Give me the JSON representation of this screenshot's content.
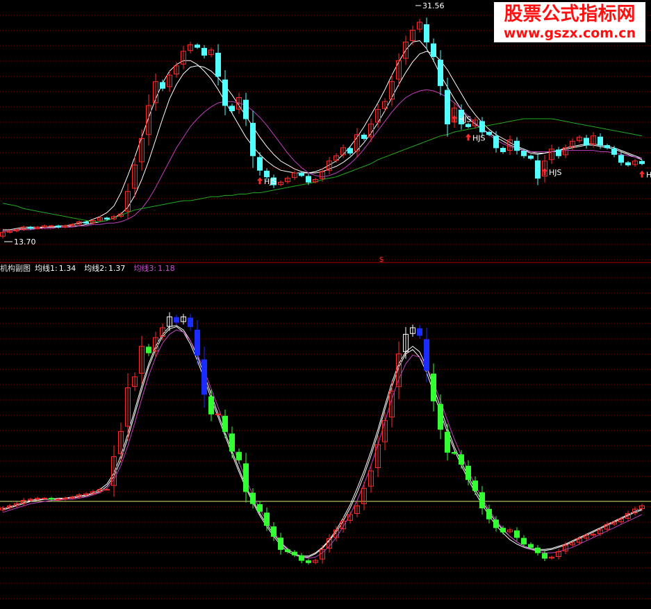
{
  "colors": {
    "up": "#ff2a2a",
    "down": "#33ff33",
    "cyan": "#54ffff",
    "blue": "#1a2cff",
    "white": "#ffffff",
    "magenta": "#c040c0",
    "green": "#22aa22",
    "grid": "#7a0000",
    "yellow": "#e8e880",
    "watermark": "#ff1010",
    "marker_text": "#ffffff"
  },
  "price_panel": {
    "high_label": "31.56",
    "low_label": "13.70",
    "marker_text": "HJS",
    "center_marker": "$"
  },
  "indicator_panel": {
    "name": "机构副图",
    "ma1_label": "均线1:",
    "ma1_value": "1.34",
    "ma2_label": "均线2:",
    "ma2_value": "1.37",
    "ma3_label": "均线3:",
    "ma3_value": "1.18"
  },
  "watermark": {
    "title": "股票公式指标网",
    "url": "www.gszx.com.cn"
  },
  "chart_data": [
    {
      "type": "candlestick",
      "title": "",
      "y_max": 31.56,
      "y_min": 13.7,
      "x": [
        1,
        2,
        3,
        4,
        5,
        6,
        7,
        8,
        9,
        10,
        11,
        12,
        13,
        14,
        15,
        16,
        17,
        18,
        19,
        20,
        21,
        22,
        23,
        24,
        25,
        26,
        27,
        28,
        29,
        30,
        31,
        32,
        33,
        34,
        35,
        36,
        37,
        38,
        39,
        40,
        41,
        42,
        43,
        44,
        45,
        46,
        47,
        48,
        49,
        50,
        51,
        52,
        53,
        54,
        55,
        56,
        57,
        58,
        59,
        60,
        61,
        62,
        63,
        64,
        65,
        66,
        67,
        68,
        69,
        70,
        71,
        72,
        73,
        74,
        75,
        76,
        77,
        78,
        79,
        80,
        81,
        82,
        83,
        84,
        85,
        86,
        87,
        88,
        89,
        90,
        91,
        92,
        93
      ],
      "close": [
        14.4,
        14.5,
        14.6,
        14.8,
        14.7,
        14.8,
        14.9,
        14.9,
        14.8,
        14.9,
        15.0,
        15.2,
        15.1,
        15.3,
        15.5,
        15.4,
        15.6,
        15.8,
        17.5,
        19.5,
        21.5,
        24.0,
        25.8,
        25.3,
        26.3,
        27.0,
        28.1,
        28.6,
        28.4,
        27.8,
        28.2,
        26.2,
        24.0,
        23.6,
        24.6,
        23.0,
        20.2,
        19.1,
        18.6,
        18.0,
        18.2,
        18.5,
        18.9,
        18.7,
        18.2,
        18.4,
        19.0,
        19.8,
        20.2,
        20.8,
        20.4,
        21.8,
        21.5,
        22.6,
        23.7,
        24.3,
        25.8,
        27.4,
        28.8,
        29.7,
        30.3,
        28.8,
        27.7,
        25.5,
        22.6,
        23.8,
        22.6,
        22.4,
        22.9,
        22.0,
        21.8,
        20.8,
        20.5,
        21.4,
        20.6,
        20.2,
        20.0,
        18.5,
        19.8,
        20.7,
        20.2,
        20.8,
        21.3,
        21.6,
        21.0,
        21.7,
        21.0,
        20.8,
        20.3,
        19.7,
        19.5,
        19.8,
        19.6
      ],
      "ma_series": [
        {
          "name": "",
          "color": "white",
          "values": [
            14.6,
            14.6,
            14.7,
            14.8,
            14.8,
            14.8,
            14.8,
            14.8,
            14.9,
            14.9,
            15.0,
            15.1,
            15.2,
            15.4,
            15.6,
            15.9,
            16.4,
            17.4,
            18.7,
            20.1,
            21.6,
            23.1,
            24.5,
            25.7,
            26.6,
            27.1,
            27.4,
            27.4,
            27.1,
            26.6,
            26.0,
            25.2,
            24.3,
            23.4,
            22.5,
            21.6,
            20.9,
            20.3,
            19.8,
            19.4,
            19.1,
            19.0,
            18.9,
            18.9,
            18.9,
            19.0,
            19.2,
            19.5,
            19.8,
            20.3,
            20.9,
            21.6,
            22.4,
            23.3,
            24.2,
            25.2,
            26.3,
            27.3,
            28.2,
            28.8,
            28.9,
            28.3,
            27.4,
            26.3,
            25.4,
            24.5,
            23.7,
            23.0,
            22.6,
            22.2,
            21.9,
            21.6,
            21.3,
            21.0,
            20.8,
            20.6,
            20.4,
            20.3,
            20.4,
            20.5,
            20.6,
            20.8,
            20.9,
            21.0,
            21.1,
            21.1,
            21.0,
            20.9,
            20.8,
            20.6,
            20.4,
            20.2,
            20.0
          ]
        },
        {
          "name": "",
          "color": "white",
          "values": [
            14.5,
            14.5,
            14.6,
            14.7,
            14.7,
            14.7,
            14.8,
            14.8,
            14.8,
            14.8,
            14.9,
            14.9,
            15.0,
            15.1,
            15.2,
            15.3,
            15.5,
            15.8,
            16.3,
            17.2,
            18.4,
            19.8,
            21.4,
            23.0,
            24.5,
            25.6,
            26.4,
            26.9,
            27.0,
            26.9,
            26.6,
            26.1,
            25.5,
            24.8,
            24.0,
            23.2,
            22.4,
            21.6,
            20.9,
            20.3,
            19.8,
            19.5,
            19.2,
            19.0,
            18.9,
            18.9,
            19.0,
            19.2,
            19.4,
            19.7,
            20.1,
            20.6,
            21.2,
            21.9,
            22.7,
            23.6,
            24.6,
            25.6,
            26.5,
            27.3,
            27.9,
            28.1,
            27.9,
            27.4,
            26.7,
            25.8,
            24.9,
            24.0,
            23.3,
            22.7,
            22.2,
            21.8,
            21.5,
            21.2,
            20.9,
            20.7,
            20.5,
            20.4,
            20.4,
            20.5,
            20.6,
            20.7,
            20.8,
            20.9,
            21.0,
            21.0,
            20.9,
            20.8,
            20.7,
            20.5,
            20.3,
            20.1,
            19.9
          ]
        },
        {
          "name": "",
          "color": "magenta",
          "values": [
            14.5,
            14.5,
            14.6,
            14.6,
            14.6,
            14.7,
            14.7,
            14.7,
            14.8,
            14.8,
            14.8,
            14.9,
            14.9,
            15.0,
            15.0,
            15.1,
            15.1,
            15.2,
            15.4,
            15.7,
            16.2,
            16.9,
            17.8,
            18.8,
            19.8,
            20.8,
            21.6,
            22.4,
            23.0,
            23.5,
            23.9,
            24.2,
            24.3,
            24.3,
            24.2,
            24.0,
            23.6,
            23.1,
            22.5,
            21.8,
            21.1,
            20.4,
            19.8,
            19.3,
            18.9,
            18.7,
            18.6,
            18.7,
            18.9,
            19.2,
            19.6,
            20.1,
            20.7,
            21.4,
            22.1,
            22.8,
            23.5,
            24.1,
            24.6,
            24.9,
            25.1,
            25.2,
            25.1,
            24.9,
            24.6,
            24.2,
            23.7,
            23.2,
            22.7,
            22.2,
            21.8,
            21.4,
            21.1,
            20.9,
            20.7,
            20.6,
            20.5,
            20.5,
            20.5,
            20.5,
            20.5,
            20.6,
            20.6,
            20.6,
            20.6,
            20.6,
            20.5,
            20.5,
            20.4,
            20.3,
            20.2,
            20.1,
            20.0
          ]
        },
        {
          "name": "",
          "color": "green",
          "values": [
            16.6,
            16.5,
            16.4,
            16.2,
            16.1,
            16.0,
            15.9,
            15.8,
            15.7,
            15.6,
            15.5,
            15.4,
            15.3,
            15.2,
            15.2,
            15.3,
            15.5,
            15.7,
            15.9,
            16.1,
            16.2,
            16.3,
            16.4,
            16.5,
            16.6,
            16.7,
            16.8,
            16.8,
            16.9,
            17.0,
            17.1,
            17.1,
            17.2,
            17.2,
            17.3,
            17.3,
            17.4,
            17.4,
            17.5,
            17.6,
            17.7,
            17.8,
            17.9,
            18.0,
            18.1,
            18.2,
            18.4,
            18.5,
            18.6,
            18.8,
            19.0,
            19.2,
            19.4,
            19.6,
            19.9,
            20.1,
            20.3,
            20.5,
            20.7,
            20.9,
            21.1,
            21.3,
            21.5,
            21.7,
            21.8,
            22.0,
            22.1,
            22.2,
            22.3,
            22.4,
            22.5,
            22.6,
            22.7,
            22.8,
            22.9,
            23.0,
            23.0,
            23.0,
            23.0,
            23.0,
            22.9,
            22.8,
            22.7,
            22.6,
            22.5,
            22.4,
            22.3,
            22.2,
            22.1,
            22.0,
            21.9,
            21.8,
            21.7
          ]
        }
      ],
      "annotations": [
        {
          "text": "31.56",
          "x": 60,
          "kind": "high"
        },
        {
          "text": "13.70",
          "x": 1,
          "kind": "low"
        },
        {
          "text": "HJS",
          "x": 38,
          "kind": "signal"
        },
        {
          "text": "HJS",
          "x": 66,
          "kind": "signal"
        },
        {
          "text": "HJS",
          "x": 68,
          "kind": "signal"
        },
        {
          "text": "HJS",
          "x": 79,
          "kind": "signal"
        },
        {
          "text": "HJS",
          "x": 93,
          "kind": "signal"
        }
      ]
    },
    {
      "type": "candlestick",
      "title": "机构副图",
      "ylim": [
        0.0,
        3.0
      ],
      "reference_line": 1.0,
      "x": [
        1,
        2,
        3,
        4,
        5,
        6,
        7,
        8,
        9,
        10,
        11,
        12,
        13,
        14,
        15,
        16,
        17,
        18,
        19,
        20,
        21,
        22,
        23,
        24,
        25,
        26,
        27,
        28,
        29,
        30,
        31,
        32,
        33,
        34,
        35,
        36,
        37,
        38,
        39,
        40,
        41,
        42,
        43,
        44,
        45,
        46,
        47,
        48,
        49,
        50,
        51,
        52,
        53,
        54,
        55,
        56,
        57,
        58,
        59,
        60,
        61,
        62,
        63,
        64,
        65,
        66,
        67,
        68,
        69,
        70,
        71,
        72,
        73,
        74,
        75,
        76,
        77,
        78,
        79,
        80,
        81,
        82,
        83,
        84,
        85,
        86,
        87,
        88,
        89,
        90,
        91,
        92,
        93
      ],
      "close": [
        0.88,
        0.9,
        0.92,
        0.95,
        0.96,
        0.97,
        0.97,
        0.96,
        0.96,
        0.97,
        0.98,
        1.0,
        1.01,
        1.03,
        1.05,
        1.05,
        1.35,
        1.58,
        1.98,
        2.08,
        2.36,
        2.3,
        2.44,
        2.53,
        2.63,
        2.58,
        2.63,
        2.54,
        2.28,
        1.92,
        1.74,
        1.74,
        1.58,
        1.4,
        1.32,
        1.03,
        0.92,
        0.85,
        0.72,
        0.62,
        0.5,
        0.48,
        0.45,
        0.4,
        0.38,
        0.4,
        0.5,
        0.6,
        0.68,
        0.76,
        0.82,
        0.9,
        1.06,
        1.22,
        1.46,
        1.68,
        1.95,
        2.29,
        2.47,
        2.53,
        2.46,
        2.14,
        1.86,
        1.6,
        1.39,
        1.38,
        1.28,
        1.14,
        1.04,
        0.88,
        0.78,
        0.7,
        0.66,
        0.68,
        0.61,
        0.55,
        0.52,
        0.47,
        0.42,
        0.43,
        0.48,
        0.54,
        0.56,
        0.6,
        0.63,
        0.64,
        0.68,
        0.73,
        0.75,
        0.78,
        0.83,
        0.87,
        0.9
      ],
      "ma_series": [
        {
          "name": "均线1",
          "color": "white",
          "values": [
            0.86,
            0.88,
            0.9,
            0.92,
            0.94,
            0.95,
            0.96,
            0.96,
            0.96,
            0.97,
            0.97,
            0.98,
            0.99,
            1.01,
            1.03,
            1.08,
            1.17,
            1.32,
            1.52,
            1.74,
            1.96,
            2.17,
            2.33,
            2.45,
            2.52,
            2.54,
            2.49,
            2.38,
            2.23,
            2.06,
            1.88,
            1.71,
            1.54,
            1.37,
            1.21,
            1.06,
            0.93,
            0.81,
            0.71,
            0.62,
            0.54,
            0.48,
            0.45,
            0.43,
            0.43,
            0.46,
            0.51,
            0.58,
            0.66,
            0.76,
            0.88,
            1.02,
            1.18,
            1.36,
            1.56,
            1.78,
            1.99,
            2.17,
            2.29,
            2.33,
            2.26,
            2.12,
            1.94,
            1.75,
            1.57,
            1.41,
            1.27,
            1.14,
            1.02,
            0.91,
            0.81,
            0.72,
            0.65,
            0.59,
            0.55,
            0.52,
            0.5,
            0.49,
            0.49,
            0.5,
            0.52,
            0.54,
            0.57,
            0.6,
            0.63,
            0.66,
            0.69,
            0.72,
            0.75,
            0.78,
            0.81,
            0.84,
            0.86
          ]
        },
        {
          "name": "均线2",
          "color": "white",
          "values": [
            0.87,
            0.89,
            0.91,
            0.93,
            0.95,
            0.96,
            0.96,
            0.96,
            0.97,
            0.97,
            0.98,
            0.99,
            1.0,
            1.02,
            1.05,
            1.1,
            1.2,
            1.36,
            1.56,
            1.78,
            2.0,
            2.2,
            2.36,
            2.47,
            2.54,
            2.55,
            2.51,
            2.41,
            2.27,
            2.1,
            1.92,
            1.74,
            1.57,
            1.4,
            1.24,
            1.08,
            0.95,
            0.83,
            0.73,
            0.64,
            0.56,
            0.5,
            0.46,
            0.44,
            0.44,
            0.47,
            0.52,
            0.59,
            0.68,
            0.79,
            0.91,
            1.06,
            1.22,
            1.4,
            1.6,
            1.82,
            2.03,
            2.2,
            2.31,
            2.36,
            2.31,
            2.17,
            1.99,
            1.8,
            1.61,
            1.44,
            1.3,
            1.17,
            1.05,
            0.94,
            0.84,
            0.75,
            0.68,
            0.62,
            0.57,
            0.53,
            0.51,
            0.5,
            0.5,
            0.51,
            0.53,
            0.55,
            0.58,
            0.61,
            0.64,
            0.67,
            0.7,
            0.73,
            0.76,
            0.79,
            0.82,
            0.85,
            0.87
          ]
        },
        {
          "name": "均线3",
          "color": "magenta",
          "values": [
            0.84,
            0.86,
            0.88,
            0.9,
            0.92,
            0.93,
            0.94,
            0.95,
            0.95,
            0.96,
            0.96,
            0.97,
            0.98,
            1.0,
            1.02,
            1.06,
            1.14,
            1.27,
            1.45,
            1.66,
            1.88,
            2.09,
            2.26,
            2.39,
            2.47,
            2.51,
            2.49,
            2.41,
            2.29,
            2.14,
            1.97,
            1.8,
            1.63,
            1.46,
            1.3,
            1.14,
            1.0,
            0.87,
            0.76,
            0.66,
            0.57,
            0.51,
            0.46,
            0.43,
            0.42,
            0.43,
            0.47,
            0.53,
            0.61,
            0.71,
            0.82,
            0.95,
            1.1,
            1.27,
            1.46,
            1.67,
            1.88,
            2.06,
            2.2,
            2.28,
            2.26,
            2.17,
            2.03,
            1.86,
            1.68,
            1.51,
            1.36,
            1.22,
            1.09,
            0.97,
            0.86,
            0.77,
            0.69,
            0.62,
            0.57,
            0.53,
            0.5,
            0.48,
            0.47,
            0.47,
            0.48,
            0.5,
            0.52,
            0.55,
            0.58,
            0.61,
            0.64,
            0.67,
            0.7,
            0.73,
            0.76,
            0.79,
            0.82
          ]
        }
      ]
    }
  ]
}
